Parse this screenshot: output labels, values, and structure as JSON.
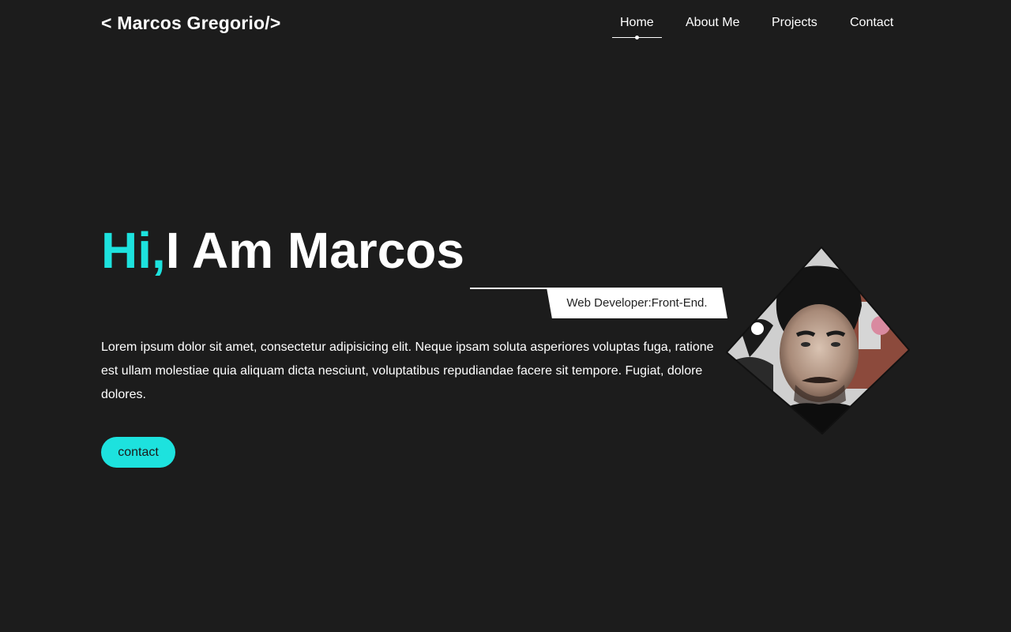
{
  "header": {
    "logo": "< Marcos Gregorio/>",
    "nav": [
      {
        "label": "Home",
        "active": true
      },
      {
        "label": "About Me",
        "active": false
      },
      {
        "label": "Projects",
        "active": false
      },
      {
        "label": "Contact",
        "active": false
      }
    ]
  },
  "hero": {
    "greeting": "Hi,",
    "name_line": "I Am Marcos",
    "role": "Web Developer:Front-End.",
    "intro": "Lorem ipsum dolor sit amet, consectetur adipisicing elit. Neque ipsam soluta asperiores voluptas fuga, ratione est ullam molestiae quia aliquam dicta nesciunt, voluptatibus repudiandae facere sit tempore. Fugiat, dolore dolores.",
    "cta_label": "contact"
  },
  "colors": {
    "background": "#1c1c1c",
    "accent": "#1de2de",
    "text": "#ffffff"
  }
}
